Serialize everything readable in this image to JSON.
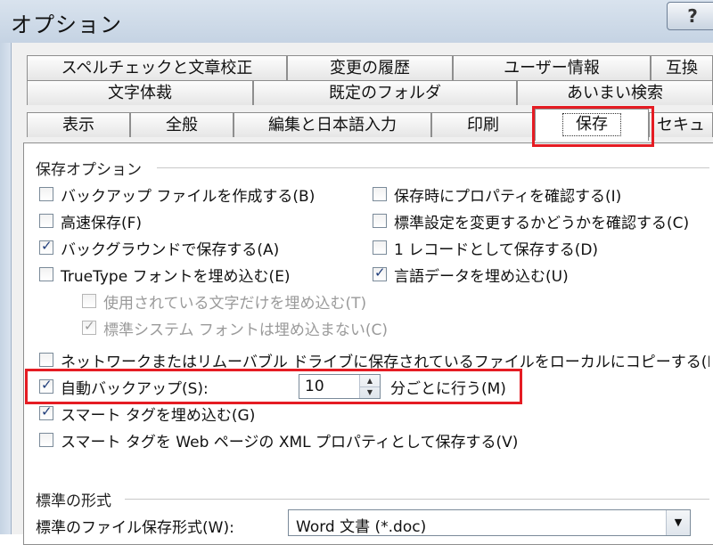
{
  "window": {
    "title": "オプション",
    "help": "?"
  },
  "tabs": {
    "row1": [
      "スペルチェックと文章校正",
      "変更の履歴",
      "ユーザー情報",
      "互換"
    ],
    "row2": [
      "文字体裁",
      "既定のフォルダ",
      "あいまい検索"
    ],
    "row3": [
      "表示",
      "全般",
      "編集と日本語入力",
      "印刷",
      "保存",
      "セキュ"
    ]
  },
  "save_options": {
    "title": "保存オプション",
    "left": [
      {
        "label": "バックアップ ファイルを作成する(B)",
        "checked": false
      },
      {
        "label": "高速保存(F)",
        "checked": false
      },
      {
        "label": "バックグラウンドで保存する(A)",
        "checked": true
      },
      {
        "label": "TrueType フォントを埋め込む(E)",
        "checked": false
      }
    ],
    "right": [
      {
        "label": "保存時にプロパティを確認する(I)",
        "checked": false
      },
      {
        "label": "標準設定を変更するかどうかを確認する(C)",
        "checked": false
      },
      {
        "label": "1 レコードとして保存する(D)",
        "checked": false
      },
      {
        "label": "言語データを埋め込む(U)",
        "checked": true
      }
    ],
    "sub": [
      {
        "label": "使用されている文字だけを埋め込む(T)",
        "checked": false
      },
      {
        "label": "標準システム フォントは埋め込まない(C)",
        "checked": true
      }
    ],
    "network_copy": {
      "label": "ネットワークまたはリムーバブル ドライブに保存されているファイルをローカルにコピーする(N)",
      "checked": false
    },
    "autobackup": {
      "label": "自動バックアップ(S):",
      "checked": true,
      "value": "10",
      "suffix": "分ごとに行う(M)"
    },
    "smart_tags": {
      "label": "スマート タグを埋め込む(G)",
      "checked": true
    },
    "smart_tags_xml": {
      "label": "スマート タグを Web ページの XML プロパティとして保存する(V)",
      "checked": false
    }
  },
  "default_format": {
    "title": "標準の形式",
    "label": "標準のファイル保存形式(W):",
    "value": "Word 文書 (*.doc)"
  },
  "colors": {
    "highlight": "#e51c23",
    "checkmark": "#1f3d7a"
  }
}
